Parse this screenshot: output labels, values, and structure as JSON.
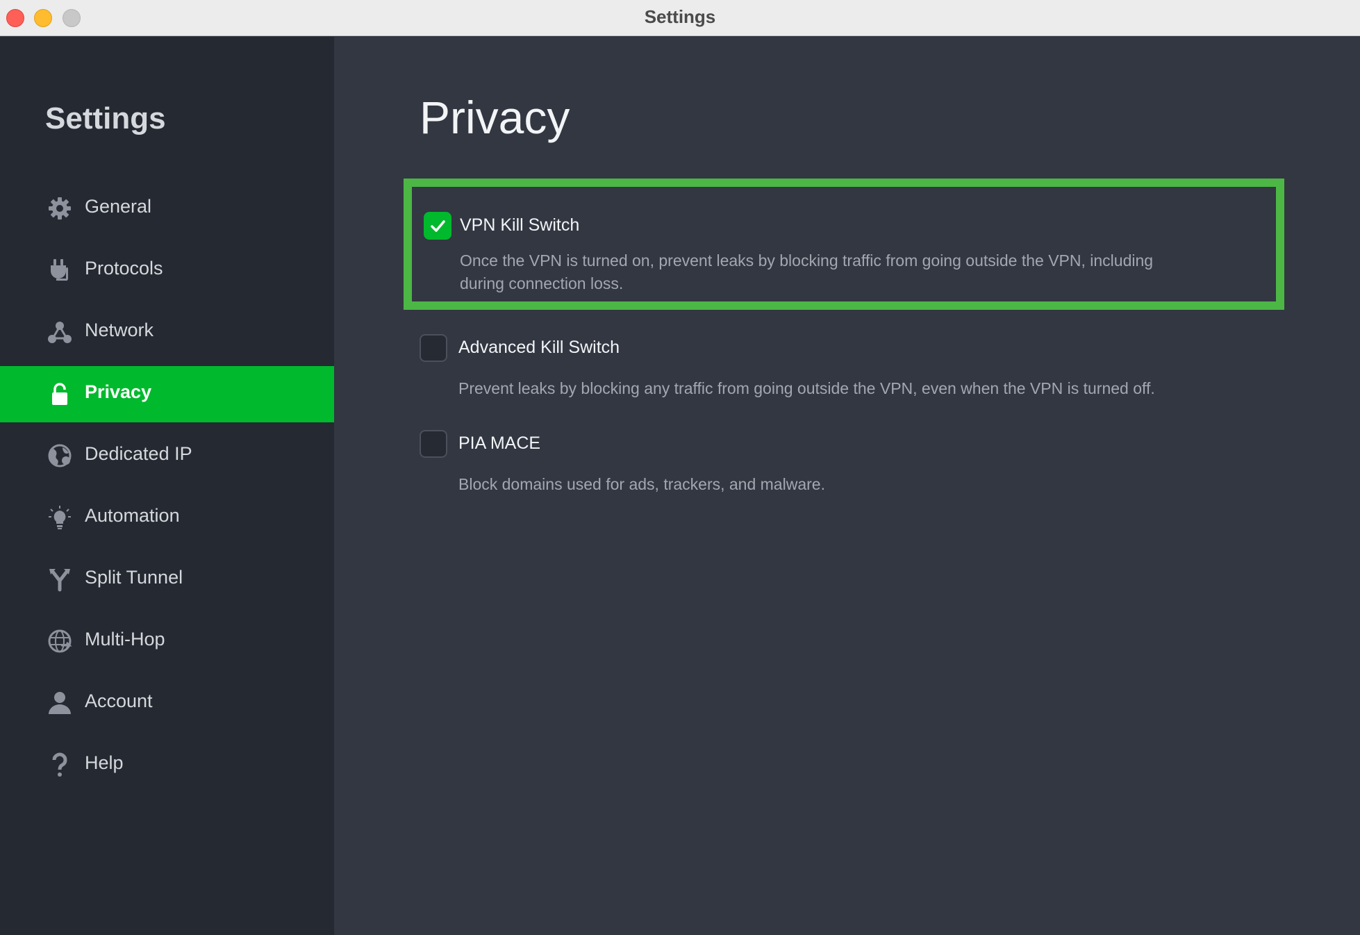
{
  "window": {
    "title": "Settings"
  },
  "sidebar": {
    "title": "Settings",
    "items": [
      {
        "label": "General",
        "icon": "gear-icon"
      },
      {
        "label": "Protocols",
        "icon": "plug-icon"
      },
      {
        "label": "Network",
        "icon": "network-icon"
      },
      {
        "label": "Privacy",
        "icon": "lock-icon",
        "active": true
      },
      {
        "label": "Dedicated IP",
        "icon": "globe-icon"
      },
      {
        "label": "Automation",
        "icon": "lightbulb-icon"
      },
      {
        "label": "Split Tunnel",
        "icon": "split-icon"
      },
      {
        "label": "Multi-Hop",
        "icon": "globe-arrows-icon"
      },
      {
        "label": "Account",
        "icon": "user-icon"
      },
      {
        "label": "Help",
        "icon": "question-icon"
      }
    ]
  },
  "main": {
    "title": "Privacy",
    "options": [
      {
        "label": "VPN Kill Switch",
        "checked": true,
        "description_line1": "Once the VPN is turned on, prevent leaks by blocking traffic from going outside the VPN, including",
        "description_line2": "during connection loss."
      },
      {
        "label": "Advanced Kill Switch",
        "checked": false,
        "description": "Prevent leaks by blocking any traffic from going outside the VPN, even when the VPN is turned off."
      },
      {
        "label": "PIA MACE",
        "checked": false,
        "description": "Block domains used for ads, trackers, and malware."
      }
    ]
  },
  "colors": {
    "accent": "#00b92c",
    "highlight_border": "#4cb745",
    "sidebar_bg": "#252931",
    "main_bg": "#323742"
  }
}
